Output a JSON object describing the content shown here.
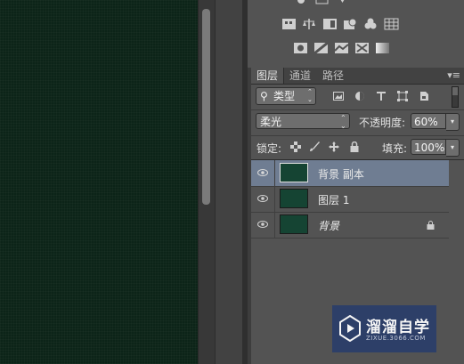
{
  "panel_tabs": {
    "layers": "图层",
    "channels": "通道",
    "paths": "路径",
    "menu_glyph": "▾≡"
  },
  "filter": {
    "kind_label": "类型",
    "search_glyph": "⚲",
    "arrows": "⌃⌄"
  },
  "blend": {
    "mode": "柔光",
    "opacity_label": "不透明度:",
    "opacity_value": "60%",
    "dropdown_glyph": "▾"
  },
  "lock": {
    "label": "锁定:",
    "fill_label": "填充:",
    "fill_value": "100%",
    "dropdown_glyph": "▾"
  },
  "layer_list": [
    {
      "name": "背景 副本",
      "selected": true
    },
    {
      "name": "图层 1",
      "selected": false
    },
    {
      "name": "背景",
      "selected": false,
      "locked": true
    }
  ],
  "watermark": {
    "title": "溜溜自学",
    "url": "ZIXUE.3066.COM"
  },
  "colors": {
    "canvas": "#0c2418",
    "panel": "#535353",
    "selection": "#6f7d92",
    "layer_thumb": "#154433"
  }
}
